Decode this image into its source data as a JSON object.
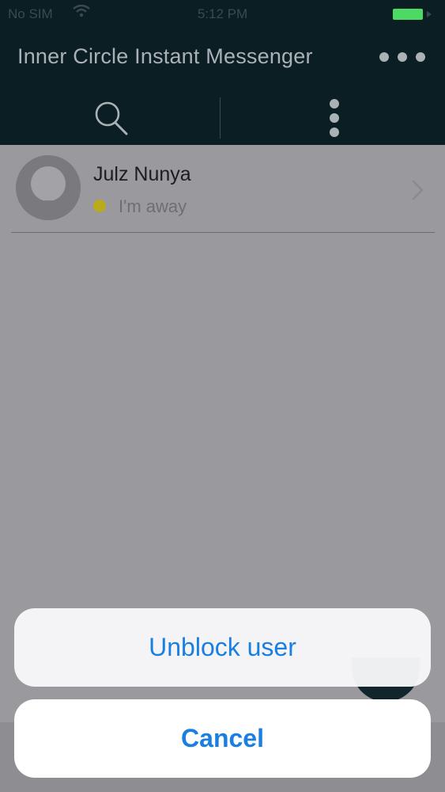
{
  "status_bar": {
    "carrier": "No SIM",
    "time": "5:12 PM"
  },
  "header": {
    "title": "Inner Circle Instant Messenger"
  },
  "toolbar": {
    "icons": [
      "search-icon",
      "more-vertical-icon"
    ]
  },
  "contacts": [
    {
      "name": "Julz Nunya",
      "status": "I'm away",
      "status_color": "#b9ab1c"
    }
  ],
  "action_sheet": {
    "actions": [
      {
        "label": "Unblock user"
      }
    ],
    "cancel_label": "Cancel"
  },
  "colors": {
    "header_bg": "#0b1e24",
    "accent": "#1a7fe0",
    "overlay": "#9a999e",
    "battery": "#4cd964"
  }
}
